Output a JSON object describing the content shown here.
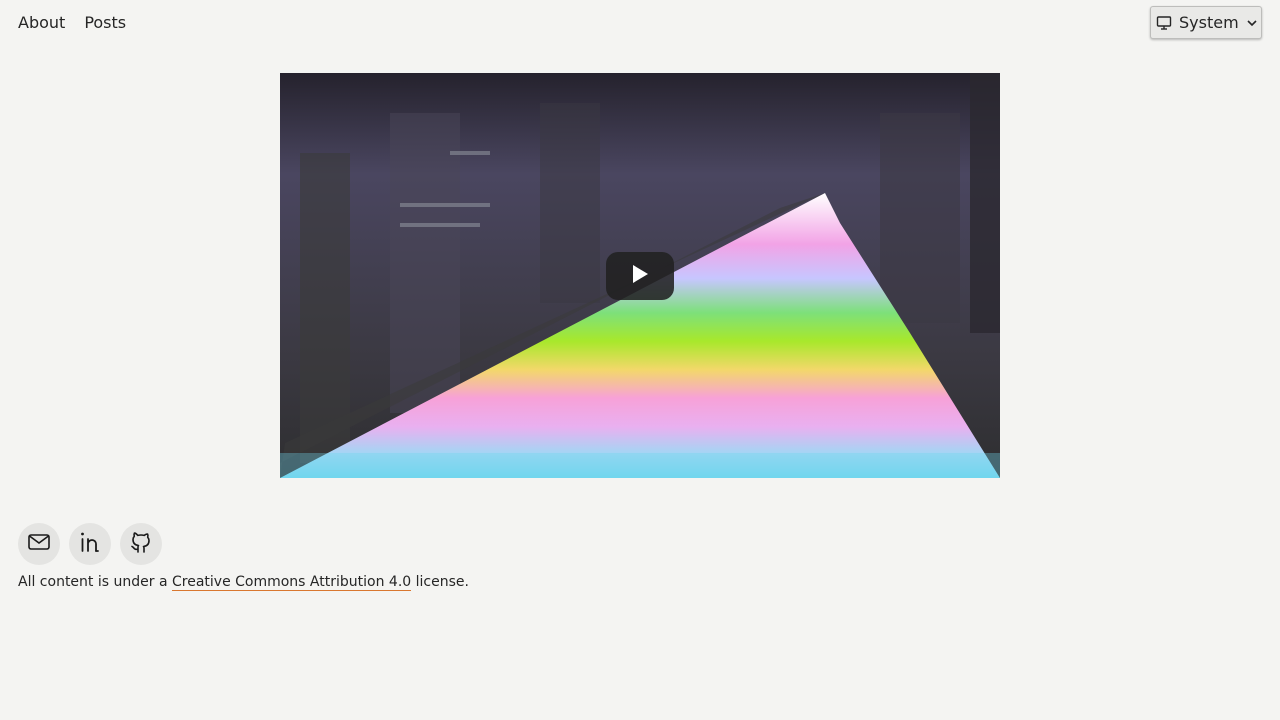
{
  "nav": {
    "about": "About",
    "posts": "Posts"
  },
  "theme_select": {
    "value": "System",
    "icon": "monitor-icon"
  },
  "video": {
    "play_icon": "play-icon"
  },
  "socials": [
    {
      "icon": "mail-icon"
    },
    {
      "icon": "linkedin-icon"
    },
    {
      "icon": "github-icon"
    }
  ],
  "footer": {
    "prefix": "All content is under a ",
    "link": "Creative Commons Attribution 4.0",
    "suffix": " license."
  },
  "colors": {
    "background": "#f4f4f2",
    "link_underline": "#d9772f",
    "text": "#262626"
  }
}
